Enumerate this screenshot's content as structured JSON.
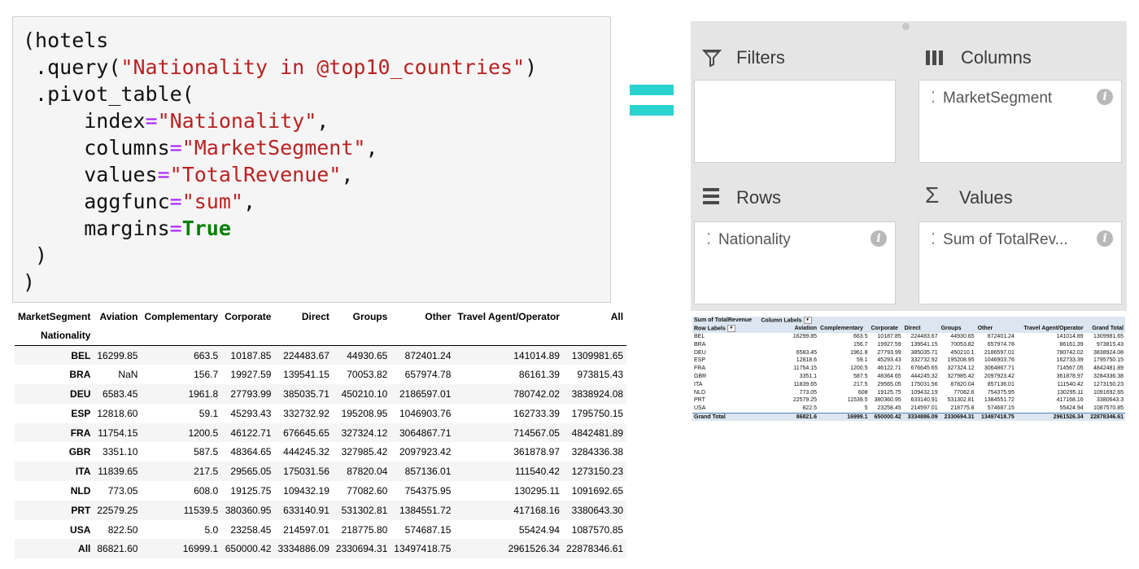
{
  "code": {
    "lines": [
      [
        {
          "t": "(hotels",
          "c": ""
        }
      ],
      [
        {
          "t": " .query(",
          "c": ""
        },
        {
          "t": "\"Nationality in @top10_countries\"",
          "c": "str"
        },
        {
          "t": ")",
          "c": ""
        }
      ],
      [
        {
          "t": " .pivot_table(",
          "c": ""
        }
      ],
      [
        {
          "t": "     index",
          "c": ""
        },
        {
          "t": "=",
          "c": "op"
        },
        {
          "t": "\"Nationality\"",
          "c": "str"
        },
        {
          "t": ",",
          "c": ""
        }
      ],
      [
        {
          "t": "     columns",
          "c": ""
        },
        {
          "t": "=",
          "c": "op"
        },
        {
          "t": "\"MarketSegment\"",
          "c": "str"
        },
        {
          "t": ",",
          "c": ""
        }
      ],
      [
        {
          "t": "     values",
          "c": ""
        },
        {
          "t": "=",
          "c": "op"
        },
        {
          "t": "\"TotalRevenue\"",
          "c": "str"
        },
        {
          "t": ",",
          "c": ""
        }
      ],
      [
        {
          "t": "     aggfunc",
          "c": ""
        },
        {
          "t": "=",
          "c": "op"
        },
        {
          "t": "\"sum\"",
          "c": "str"
        },
        {
          "t": ",",
          "c": ""
        }
      ],
      [
        {
          "t": "     margins",
          "c": ""
        },
        {
          "t": "=",
          "c": "op"
        },
        {
          "t": "True",
          "c": "kw"
        }
      ],
      [
        {
          "t": " )",
          "c": ""
        }
      ],
      [
        {
          "t": ")",
          "c": ""
        }
      ]
    ]
  },
  "dataframe": {
    "columns_name": "MarketSegment",
    "index_name": "Nationality",
    "columns": [
      "Aviation",
      "Complementary",
      "Corporate",
      "Direct",
      "Groups",
      "Other",
      "Travel Agent/Operator",
      "All"
    ],
    "rows": [
      {
        "label": "BEL",
        "values": [
          "16299.85",
          "663.5",
          "10187.85",
          "224483.67",
          "44930.65",
          "872401.24",
          "141014.89",
          "1309981.65"
        ]
      },
      {
        "label": "BRA",
        "values": [
          "NaN",
          "156.7",
          "19927.59",
          "139541.15",
          "70053.82",
          "657974.78",
          "86161.39",
          "973815.43"
        ]
      },
      {
        "label": "DEU",
        "values": [
          "6583.45",
          "1961.8",
          "27793.99",
          "385035.71",
          "450210.10",
          "2186597.01",
          "780742.02",
          "3838924.08"
        ]
      },
      {
        "label": "ESP",
        "values": [
          "12818.60",
          "59.1",
          "45293.43",
          "332732.92",
          "195208.95",
          "1046903.76",
          "162733.39",
          "1795750.15"
        ]
      },
      {
        "label": "FRA",
        "values": [
          "11754.15",
          "1200.5",
          "46122.71",
          "676645.65",
          "327324.12",
          "3064867.71",
          "714567.05",
          "4842481.89"
        ]
      },
      {
        "label": "GBR",
        "values": [
          "3351.10",
          "587.5",
          "48364.65",
          "444245.32",
          "327985.42",
          "2097923.42",
          "361878.97",
          "3284336.38"
        ]
      },
      {
        "label": "ITA",
        "values": [
          "11839.65",
          "217.5",
          "29565.05",
          "175031.56",
          "87820.04",
          "857136.01",
          "111540.42",
          "1273150.23"
        ]
      },
      {
        "label": "NLD",
        "values": [
          "773.05",
          "608.0",
          "19125.75",
          "109432.19",
          "77082.60",
          "754375.95",
          "130295.11",
          "1091692.65"
        ]
      },
      {
        "label": "PRT",
        "values": [
          "22579.25",
          "11539.5",
          "380360.95",
          "633140.91",
          "531302.81",
          "1384551.72",
          "417168.16",
          "3380643.30"
        ]
      },
      {
        "label": "USA",
        "values": [
          "822.50",
          "5.0",
          "23258.45",
          "214597.01",
          "218775.80",
          "574687.15",
          "55424.94",
          "1087570.85"
        ]
      },
      {
        "label": "All",
        "values": [
          "86821.60",
          "16999.1",
          "650000.42",
          "3334886.09",
          "2330694.31",
          "13497418.75",
          "2961526.34",
          "22878346.61"
        ]
      }
    ]
  },
  "pivot_panel": {
    "filters": {
      "title": "Filters",
      "icon": "filter-icon",
      "fields": []
    },
    "columns": {
      "title": "Columns",
      "icon": "columns-icon",
      "field": "MarketSegment"
    },
    "rows": {
      "title": "Rows",
      "icon": "rows-icon",
      "field": "Nationality"
    },
    "values": {
      "title": "Values",
      "icon": "sigma-icon",
      "field": "Sum of TotalRev..."
    },
    "info_glyph": "i"
  },
  "excel_pivot": {
    "corner": "Sum of TotalRevenue",
    "column_labels": "Column Labels",
    "row_labels": "Row Labels",
    "columns": [
      "Aviation",
      "Complementary",
      "Corporate",
      "Direct",
      "Groups",
      "Other",
      "Travel Agent/Operator",
      "Grand Total"
    ],
    "rows": [
      {
        "label": "BEL",
        "values": [
          "16299.85",
          "663.5",
          "10187.85",
          "224483.67",
          "44930.65",
          "872401.24",
          "141014.89",
          "1309981.65"
        ]
      },
      {
        "label": "BRA",
        "values": [
          "",
          "156.7",
          "19927.59",
          "139541.15",
          "70053.82",
          "657974.78",
          "86161.39",
          "973815.43"
        ]
      },
      {
        "label": "DEU",
        "values": [
          "6583.45",
          "1961.8",
          "27793.99",
          "385035.71",
          "450210.1",
          "2186597.01",
          "780742.02",
          "3838924.08"
        ]
      },
      {
        "label": "ESP",
        "values": [
          "12818.6",
          "59.1",
          "45293.43",
          "332732.92",
          "195208.95",
          "1046903.76",
          "162733.39",
          "1795750.15"
        ]
      },
      {
        "label": "FRA",
        "values": [
          "11754.15",
          "1200.5",
          "46122.71",
          "676645.65",
          "327324.12",
          "3064867.71",
          "714567.05",
          "4842481.89"
        ]
      },
      {
        "label": "GBR",
        "values": [
          "3351.1",
          "587.5",
          "48364.65",
          "444245.32",
          "327985.42",
          "2097923.42",
          "361878.97",
          "3284336.38"
        ]
      },
      {
        "label": "ITA",
        "values": [
          "11839.65",
          "217.5",
          "29565.05",
          "175031.56",
          "87820.04",
          "857136.01",
          "111540.42",
          "1273150.23"
        ]
      },
      {
        "label": "NLD",
        "values": [
          "773.05",
          "608",
          "19125.75",
          "109432.19",
          "77082.6",
          "754375.95",
          "130295.11",
          "1091692.65"
        ]
      },
      {
        "label": "PRT",
        "values": [
          "22579.25",
          "11539.5",
          "380360.95",
          "633140.91",
          "531302.81",
          "1384551.72",
          "417168.16",
          "3380643.3"
        ]
      },
      {
        "label": "USA",
        "values": [
          "822.5",
          "5",
          "23258.45",
          "214597.01",
          "218775.8",
          "574687.15",
          "55424.94",
          "1087570.85"
        ]
      }
    ],
    "total": {
      "label": "Grand Total",
      "values": [
        "86821.6",
        "16999.1",
        "650000.42",
        "3334886.09",
        "2330694.31",
        "13497418.75",
        "2961526.34",
        "22878346.61"
      ]
    }
  },
  "colors": {
    "accent_equals": "#2bd3cf",
    "string": "#ba2121",
    "operator": "#aa22ff",
    "keyword": "#008000"
  }
}
